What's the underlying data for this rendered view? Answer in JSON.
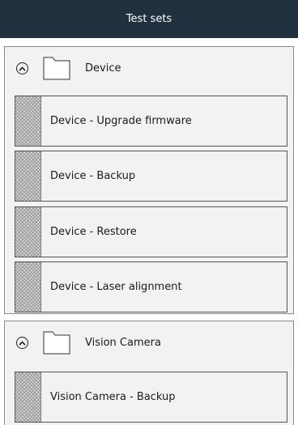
{
  "header": {
    "title": "Test sets"
  },
  "groups": [
    {
      "label": "Device",
      "items": [
        {
          "label": "Device - Upgrade firmware"
        },
        {
          "label": "Device - Backup"
        },
        {
          "label": "Device - Restore"
        },
        {
          "label": "Device - Laser alignment"
        }
      ]
    },
    {
      "label": "Vision Camera",
      "items": [
        {
          "label": "Vision Camera - Backup"
        }
      ]
    }
  ],
  "icons": {
    "toggle": "chevron-up-circle-icon",
    "folder": "folder-icon",
    "item": "test-set-pattern-icon"
  }
}
